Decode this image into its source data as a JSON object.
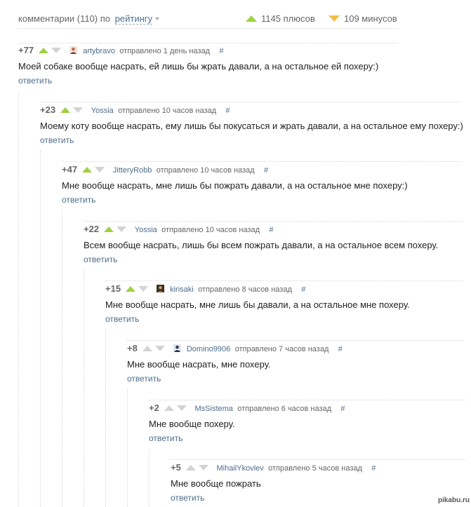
{
  "header": {
    "comments_label": "комментарии (110) по",
    "sort_label": "рейтингу",
    "plus_label": "1145 плюсов",
    "minus_label": "109 минусов"
  },
  "common": {
    "reply_label": "ответить",
    "hash": "#"
  },
  "comments": [
    {
      "rating": "+77",
      "author": "artybravo",
      "posted": "отправлено 1 день назад",
      "text": "Моей собаке вообще насрать, ей лишь бы жрать давали, а на остальное ей похеру:)"
    },
    {
      "rating": "+23",
      "author": "Yossia",
      "posted": "отправлено 10 часов назад",
      "text": "Моему коту вообще насрать, ему лишь бы покусаться и жрать давали, а на остальное ему похеру:)"
    },
    {
      "rating": "+47",
      "author": "JitteryRobb",
      "posted": "отправлено 10 часов назад",
      "text": "Мне вообще насрать, мне лишь бы пожрать давали, а на остальное мне похеру:)"
    },
    {
      "rating": "+22",
      "author": "Yossia",
      "posted": "отправлено 10 часов назад",
      "text": "Всем вообще насрать, лишь бы всем пожрать давали, а на остальное всем похеру."
    },
    {
      "rating": "+15",
      "author": "kirisaki",
      "posted": "отправлено 8 часов назад",
      "text": "Мне вообще насрать, мне лишь бы давали, а на остальное мне похеру."
    },
    {
      "rating": "+8",
      "author": "Domino9906",
      "posted": "отправлено 7 часов назад",
      "text": "Мне вообще насрать, мне похеру."
    },
    {
      "rating": "+2",
      "author": "MsSistema",
      "posted": "отправлено 6 часов назад",
      "text": "Мне вообще похеру."
    },
    {
      "rating": "+5",
      "author": "MihailYkovlev",
      "posted": "отправлено 5 часов назад",
      "text": "Мне вообще пожрать"
    }
  ],
  "watermark": "pikabu.ru",
  "colors": {
    "accent": "#4d6d8b",
    "plus": "#9ed13f",
    "minus": "#f0c04a",
    "muted": "#d3d3d3"
  }
}
